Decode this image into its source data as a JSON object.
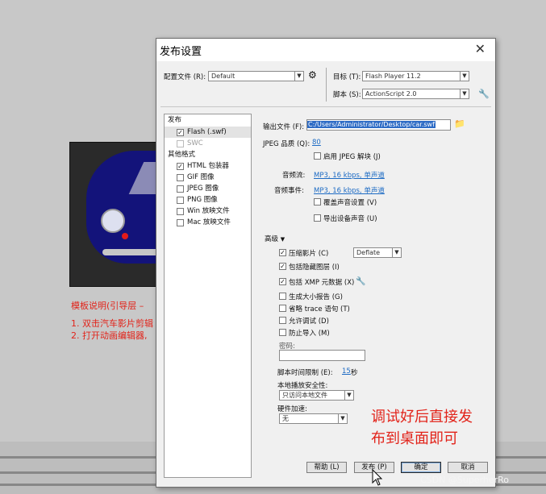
{
  "background": {
    "template_note_title": "模板说明(引导层 – ",
    "template_steps": [
      "1. 双击汽车影片剪辑",
      "2. 打开动画编辑器,"
    ],
    "watermark": "CSDN @SuperherRo"
  },
  "annotation": {
    "line1": "调试好后直接发",
    "line2": "布到桌面即可"
  },
  "dialog": {
    "title": "发布设置",
    "profile_label": "配置文件 (R):",
    "profile_value": "Default",
    "target_label": "目标 (T):",
    "target_value": "Flash Player 11.2",
    "script_label": "脚本 (S):",
    "script_value": "ActionScript 2.0",
    "list": {
      "publish_header": "发布",
      "items": [
        {
          "label": "Flash (.swf)",
          "checked": true
        },
        {
          "label": "SWC",
          "checked": false,
          "disabled": true
        }
      ],
      "other_header": "其他格式",
      "other_items": [
        {
          "label": "HTML 包装器",
          "checked": true
        },
        {
          "label": "GIF 图像",
          "checked": false
        },
        {
          "label": "JPEG 图像",
          "checked": false
        },
        {
          "label": "PNG 图像",
          "checked": false
        },
        {
          "label": "Win 放映文件",
          "checked": false
        },
        {
          "label": "Mac 放映文件",
          "checked": false
        }
      ]
    },
    "output_label": "输出文件 (F):",
    "output_value": "C:/Users/Administrator/Desktop/car.swf",
    "jpeg_quality_label": "JPEG 品质 (Q):",
    "jpeg_quality_value": "80",
    "jpeg_deblock_label": "启用 JPEG 解块 (J)",
    "audio_stream_label": "音频流:",
    "audio_stream_value": "MP3, 16 kbps, 单声道",
    "audio_event_label": "音频事件:",
    "audio_event_value": "MP3, 16 kbps, 单声道",
    "override_sound_label": "覆盖声音设置 (V)",
    "export_device_sound_label": "导出设备声音 (U)",
    "advanced_label": "高级",
    "compress_label": "压缩影片 (C)",
    "compress_value": "Deflate",
    "include_hidden_label": "包括隐藏图层 (I)",
    "include_xmp_label": "包括 XMP 元数据 (X)",
    "size_report_label": "生成大小报告 (G)",
    "omit_trace_label": "省略 trace 语句 (T)",
    "permit_debug_label": "允许调试 (D)",
    "protect_import_label": "防止导入 (M)",
    "password_label": "密码:",
    "script_time_label": "脚本时间限制 (E):",
    "script_time_value": "15",
    "script_time_unit": "秒",
    "local_security_label": "本地播放安全性:",
    "local_security_value": "只访问本地文件",
    "hw_accel_label": "硬件加速:",
    "hw_accel_value": "无",
    "buttons": {
      "help": "帮助 (L)",
      "publish": "发布 (P)",
      "ok": "确定",
      "cancel": "取消"
    }
  }
}
